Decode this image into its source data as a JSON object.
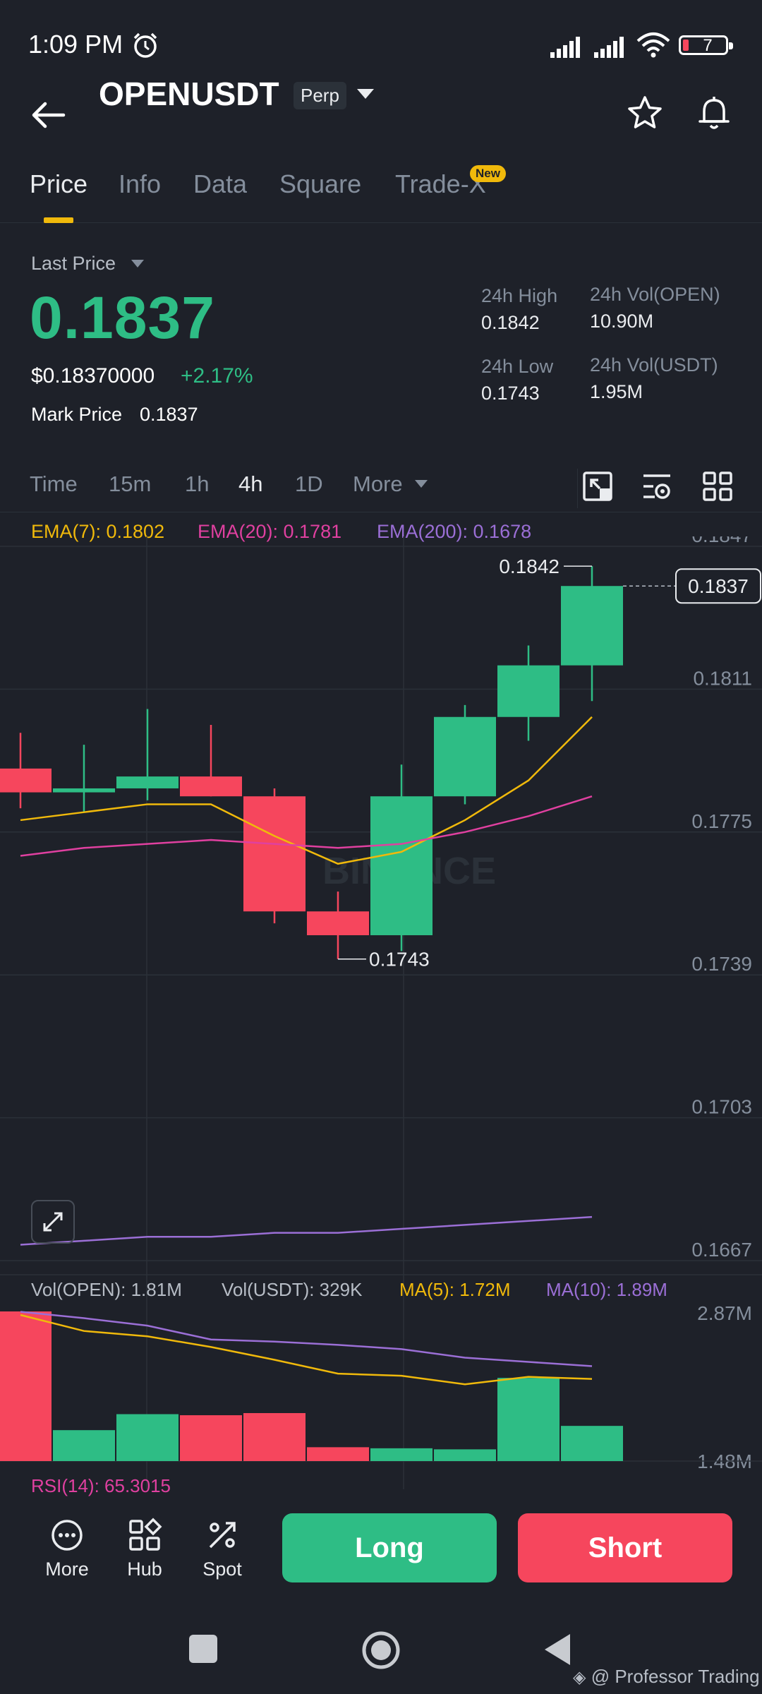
{
  "status": {
    "time": "1:09 PM",
    "battery": "7"
  },
  "header": {
    "pair": "OPENUSDT",
    "badge": "Perp"
  },
  "tabs": [
    {
      "label": "Price"
    },
    {
      "label": "Info"
    },
    {
      "label": "Data"
    },
    {
      "label": "Square"
    },
    {
      "label": "Trade-X"
    }
  ],
  "new_badge": "New",
  "price": {
    "last_price_label": "Last Price",
    "value": "0.1837",
    "usd": "$0.18370000",
    "change": "+2.17%",
    "mark_label": "Mark Price",
    "mark_value": "0.1837"
  },
  "stats": {
    "high_label": "24h High",
    "high_value": "0.1842",
    "vol_open_label": "24h Vol(OPEN)",
    "vol_open_value": "10.90M",
    "low_label": "24h Low",
    "low_value": "0.1743",
    "vol_usdt_label": "24h Vol(USDT)",
    "vol_usdt_value": "1.95M"
  },
  "intervals": [
    "Time",
    "15m",
    "1h",
    "4h",
    "1D",
    "More"
  ],
  "active_interval": "4h",
  "ema": {
    "ema7": "EMA(7): 0.1802",
    "ema20": "EMA(20): 0.1781",
    "ema200": "EMA(200): 0.1678"
  },
  "volume": {
    "vol_open": "Vol(OPEN): 1.81M",
    "vol_usdt": "Vol(USDT): 329K",
    "ma5": "MA(5): 1.72M",
    "ma10": "MA(10): 1.89M"
  },
  "rsi": "RSI(14): 65.3015",
  "bottom": {
    "more": "More",
    "hub": "Hub",
    "spot": "Spot",
    "long": "Long",
    "short": "Short"
  },
  "watermark": "@ Professor Trading",
  "colors": {
    "up": "#2ebd85",
    "down": "#f6465d",
    "ema7": "#f0b90b",
    "ema20": "#e040a0",
    "ema200": "#9b6fd6",
    "bg": "#1e2129"
  },
  "chart_data": {
    "type": "candlestick",
    "interval": "4h",
    "y_ticks": [
      "0.1847",
      "0.1811",
      "0.1775",
      "0.1739",
      "0.1703",
      "0.1667"
    ],
    "ylim": [
      0.1667,
      0.1847
    ],
    "candles": [
      {
        "o": 0.1791,
        "h": 0.18,
        "l": 0.1781,
        "c": 0.1785
      },
      {
        "o": 0.1785,
        "h": 0.1797,
        "l": 0.178,
        "c": 0.1786
      },
      {
        "o": 0.1786,
        "h": 0.1806,
        "l": 0.1783,
        "c": 0.1789
      },
      {
        "o": 0.1789,
        "h": 0.1802,
        "l": 0.1784,
        "c": 0.1784
      },
      {
        "o": 0.1784,
        "h": 0.1786,
        "l": 0.1752,
        "c": 0.1755
      },
      {
        "o": 0.1755,
        "h": 0.176,
        "l": 0.1743,
        "c": 0.1749
      },
      {
        "o": 0.1749,
        "h": 0.1792,
        "l": 0.1745,
        "c": 0.1784
      },
      {
        "o": 0.1784,
        "h": 0.1807,
        "l": 0.1782,
        "c": 0.1804
      },
      {
        "o": 0.1804,
        "h": 0.1822,
        "l": 0.1798,
        "c": 0.1817
      },
      {
        "o": 0.1817,
        "h": 0.1842,
        "l": 0.1808,
        "c": 0.1837
      }
    ],
    "ema7": [
      0.1778,
      0.178,
      0.1782,
      0.1782,
      0.1774,
      0.1767,
      0.177,
      0.1778,
      0.1788,
      0.1804
    ],
    "ema20": [
      0.1769,
      0.1771,
      0.1772,
      0.1773,
      0.1772,
      0.1771,
      0.1772,
      0.1775,
      0.1779,
      0.1784
    ],
    "ema200": [
      0.1671,
      0.1672,
      0.1673,
      0.1673,
      0.1674,
      0.1674,
      0.1675,
      0.1676,
      0.1677,
      0.1678
    ],
    "high_label": "0.1842",
    "low_label": "0.1743",
    "last_label": "0.1837",
    "volume_ticks": [
      "2.87M",
      "1.48M"
    ],
    "volume_values": [
      2.92,
      1.77,
      1.92,
      1.91,
      1.93,
      1.61,
      1.6,
      1.59,
      2.26,
      1.81
    ],
    "ma5": [
      2.85,
      2.7,
      2.65,
      2.55,
      2.43,
      2.3,
      2.28,
      2.2,
      2.27,
      2.25
    ],
    "ma10": [
      2.88,
      2.82,
      2.75,
      2.62,
      2.6,
      2.57,
      2.53,
      2.45,
      2.41,
      2.37
    ]
  }
}
